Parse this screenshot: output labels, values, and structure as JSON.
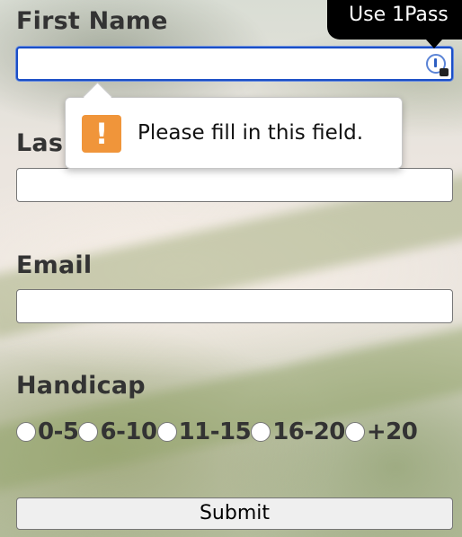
{
  "form": {
    "first_name": {
      "label": "First Name",
      "value": ""
    },
    "last_name": {
      "label": "Las",
      "value": ""
    },
    "email": {
      "label": "Email",
      "value": ""
    },
    "handicap": {
      "label": "Handicap",
      "options": [
        "0-5",
        "6-10",
        "11-15",
        "16-20",
        "+20"
      ]
    },
    "submit_label": "Submit"
  },
  "onepassword_tooltip": {
    "text": "Use 1Pass"
  },
  "validation_popup": {
    "message": "Please fill in this field.",
    "icon": "!"
  },
  "colors": {
    "focus_ring": "#1a4ec6",
    "warning": "#f0953a",
    "label_text": "#333333"
  },
  "icons": [
    "onepassword-icon",
    "warning-icon",
    "lock-icon"
  ]
}
